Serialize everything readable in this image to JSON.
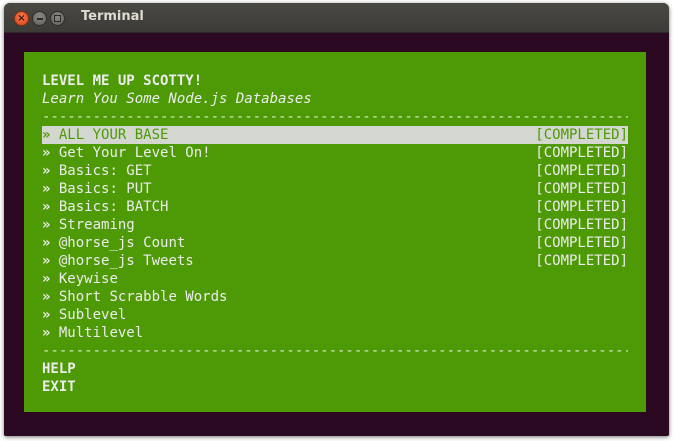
{
  "window": {
    "title": "Terminal",
    "close_glyph": "×",
    "colors": {
      "terminal_background": "#2c0922",
      "panel_background": "#4e9a06",
      "text": "#ececec",
      "selection_background": "#d3d7cf"
    }
  },
  "app": {
    "title": "LEVEL ME UP SCOTTY!",
    "subtitle": "Learn You Some Node.js Databases",
    "divider": "----------------------------------------------------------------------------------------------------",
    "marker": "»",
    "menu": [
      {
        "label": "ALL YOUR BASE",
        "status": "[COMPLETED]",
        "selected": true
      },
      {
        "label": "Get Your Level On!",
        "status": "[COMPLETED]",
        "selected": false
      },
      {
        "label": "Basics: GET",
        "status": "[COMPLETED]",
        "selected": false
      },
      {
        "label": "Basics: PUT",
        "status": "[COMPLETED]",
        "selected": false
      },
      {
        "label": "Basics: BATCH",
        "status": "[COMPLETED]",
        "selected": false
      },
      {
        "label": "Streaming",
        "status": "[COMPLETED]",
        "selected": false
      },
      {
        "label": "@horse_js Count",
        "status": "[COMPLETED]",
        "selected": false
      },
      {
        "label": "@horse_js Tweets",
        "status": "[COMPLETED]",
        "selected": false
      },
      {
        "label": "Keywise",
        "status": "",
        "selected": false
      },
      {
        "label": "Short Scrabble Words",
        "status": "",
        "selected": false
      },
      {
        "label": "Sublevel",
        "status": "",
        "selected": false
      },
      {
        "label": "Multilevel",
        "status": "",
        "selected": false
      }
    ],
    "footer": {
      "help": "HELP",
      "exit": "EXIT"
    }
  }
}
